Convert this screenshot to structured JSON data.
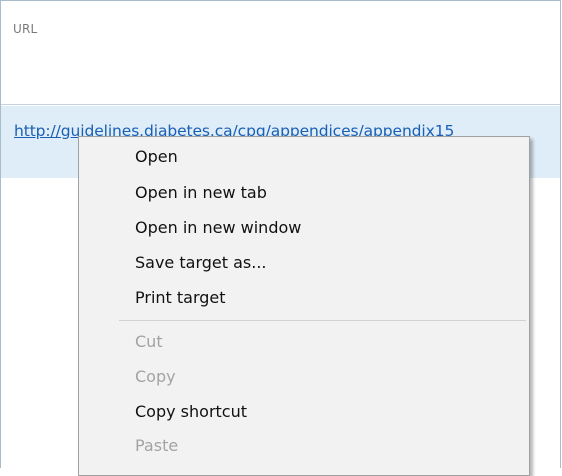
{
  "header": {
    "column_label": "URL"
  },
  "row": {
    "url": "http://guidelines.diabetes.ca/cpg/appendices/appendix15"
  },
  "context_menu": {
    "items": [
      {
        "label": "Open",
        "enabled": true
      },
      {
        "label": "Open in new tab",
        "enabled": true
      },
      {
        "label": "Open in new window",
        "enabled": true
      },
      {
        "label": "Save target as...",
        "enabled": true
      },
      {
        "label": "Print target",
        "enabled": true
      },
      {
        "label": "Cut",
        "enabled": false
      },
      {
        "label": "Copy",
        "enabled": false
      },
      {
        "label": "Copy shortcut",
        "enabled": true
      },
      {
        "label": "Paste",
        "enabled": false
      }
    ]
  }
}
